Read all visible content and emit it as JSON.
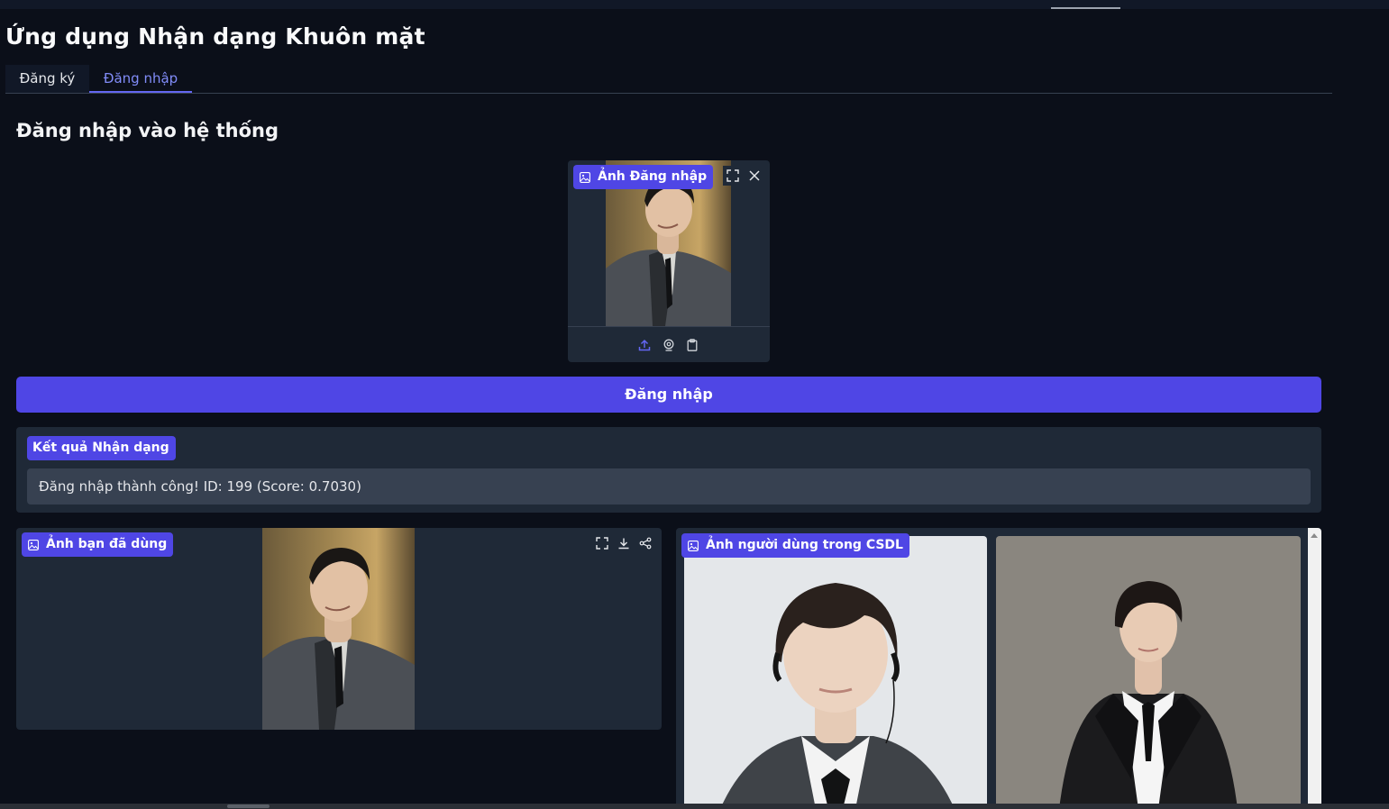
{
  "app": {
    "title": "Ứng dụng Nhận dạng Khuôn mặt"
  },
  "tabs": [
    {
      "label": "Đăng ký",
      "active": false
    },
    {
      "label": "Đăng nhập",
      "active": true
    }
  ],
  "login": {
    "section_title": "Đăng nhập vào hệ thống",
    "image_label": "Ảnh Đăng nhập",
    "button_label": "Đăng nhập",
    "upload_icons": [
      "upload-icon",
      "webcam-icon",
      "clipboard-icon"
    ],
    "header_icons": [
      "fullscreen-icon",
      "close-icon"
    ]
  },
  "result": {
    "label": "Kết quả Nhận dạng",
    "value": "Đăng nhập thành công! ID: 199 (Score: 0.7030)"
  },
  "used_image": {
    "label": "Ảnh bạn đã dùng",
    "toolbar_icons": [
      "fullscreen-icon",
      "download-icon",
      "share-icon"
    ]
  },
  "db_gallery": {
    "label": "Ảnh người dùng trong CSDL",
    "image_count_visible": 2
  },
  "colors": {
    "background": "#0b0f19",
    "panel": "#1f2937",
    "accent": "#4f46e5",
    "tab_active": "#818cf8",
    "field": "#374151"
  }
}
